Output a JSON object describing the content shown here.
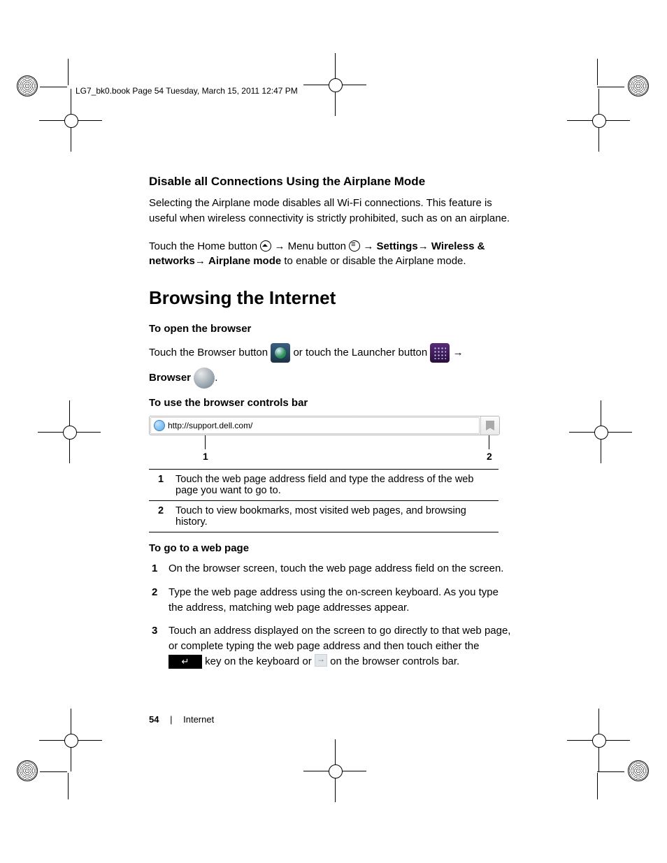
{
  "doc_header": "LG7_bk0.book  Page 54  Tuesday, March 15, 2011  12:47 PM",
  "section_airplane": {
    "title": "Disable all Connections Using the Airplane Mode",
    "para": "Selecting the Airplane mode disables all Wi-Fi connections. This feature is useful when wireless connectivity is strictly prohibited, such as on an airplane.",
    "path_pre": "Touch the Home button ",
    "path_mid1": " Menu button ",
    "path_settings": "Settings",
    "path_wireless": "Wireless & networks",
    "path_airplane": "Airplane mode",
    "path_post": " to enable or disable the Airplane mode.",
    "arrow": "→"
  },
  "section_browse": {
    "title": "Browsing the Internet",
    "open_h": "To open the browser",
    "open_pre": "Touch the Browser button ",
    "open_mid": " or touch the Launcher button ",
    "open_arrow": "→",
    "open_browser": "Browser",
    "open_period": "."
  },
  "controls": {
    "title": "To use the browser controls bar",
    "address": "http://support.dell.com/",
    "callout1": "1",
    "callout2": "2",
    "row1_num": "1",
    "row1_txt": "Touch the web page address field and type the address of the web page you want to go to.",
    "row2_num": "2",
    "row2_txt": "Touch to view bookmarks, most visited web pages, and browsing history."
  },
  "goto": {
    "title": "To go to a web page",
    "s1": "On the browser screen, touch the web page address field on the screen.",
    "s2": "Type the web page address using the on-screen keyboard. As you type the address, matching web page addresses appear.",
    "s3a": "Touch an address displayed on the screen to go directly to that web page, or complete typing the web page address and then touch either the ",
    "s3b": " key on the keyboard or ",
    "s3c": " on the browser controls bar.",
    "enter_glyph": "↵"
  },
  "footer": {
    "page": "54",
    "sep": "|",
    "section": "Internet"
  }
}
